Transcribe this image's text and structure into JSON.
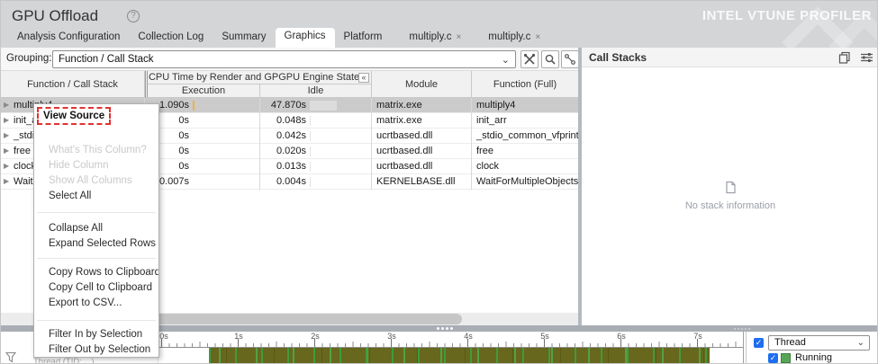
{
  "header": {
    "title": "GPU Offload",
    "help_icon": "?",
    "brand": "INTEL VTUNE PROFILER"
  },
  "tabs": [
    {
      "label": "Analysis Configuration",
      "active": false,
      "closable": false
    },
    {
      "label": "Collection Log",
      "active": false,
      "closable": false
    },
    {
      "label": "Summary",
      "active": false,
      "closable": false
    },
    {
      "label": "Graphics",
      "active": true,
      "closable": false
    },
    {
      "label": "Platform",
      "active": false,
      "closable": false
    },
    {
      "label": "multiply.c",
      "active": false,
      "closable": true,
      "close_glyph": "×"
    },
    {
      "label": "multiply.c",
      "active": false,
      "closable": true,
      "close_glyph": "×"
    }
  ],
  "grouping": {
    "label": "Grouping:",
    "value": "Function / Call Stack",
    "buttons": [
      "customize-grouping",
      "search",
      "grouping-path"
    ]
  },
  "table": {
    "col_function": "Function / Call Stack",
    "group_header": "CPU Time by Render and GPGPU Engine State",
    "group_sort_glyph": "▼",
    "group_collapse_glyph": "«",
    "col_execution": "Execution",
    "col_idle": "Idle",
    "col_module": "Module",
    "col_function_full": "Function (Full)",
    "expand_glyph": "▶",
    "rows": [
      {
        "name": "multiply4",
        "execution": "1.090s",
        "idle": "47.870s",
        "module": "matrix.exe",
        "function_full": "multiply4",
        "selected": true
      },
      {
        "name": "init_arr",
        "execution": "0s",
        "idle": "0.048s",
        "module": "matrix.exe",
        "function_full": "init_arr",
        "selected": false
      },
      {
        "name": "_stdio_common_vfprintf",
        "execution": "0s",
        "idle": "0.042s",
        "module": "ucrtbased.dll",
        "function_full": "_stdio_common_vfprintf",
        "selected": false
      },
      {
        "name": "free",
        "execution": "0s",
        "idle": "0.020s",
        "module": "ucrtbased.dll",
        "function_full": "free",
        "selected": false
      },
      {
        "name": "clock",
        "execution": "0s",
        "idle": "0.013s",
        "module": "ucrtbased.dll",
        "function_full": "clock",
        "selected": false
      },
      {
        "name": "WaitForMultipleObjects",
        "execution": "0.007s",
        "idle": "0.004s",
        "module": "KERNELBASE.dll",
        "function_full": "WaitForMultipleObjects",
        "selected": false
      }
    ]
  },
  "context_menu": {
    "items": [
      {
        "label": "View Source",
        "state": "highlighted"
      },
      {
        "label": "What's This Column?",
        "state": "disabled"
      },
      {
        "label": "Hide Column",
        "state": "disabled"
      },
      {
        "label": "Show All Columns",
        "state": "disabled"
      },
      {
        "label": "Select All",
        "state": "normal"
      },
      {
        "label": "Collapse All",
        "state": "normal"
      },
      {
        "label": "Expand Selected Rows",
        "state": "normal"
      },
      {
        "label": "Copy Rows to Clipboard",
        "state": "normal"
      },
      {
        "label": "Copy Cell to Clipboard",
        "state": "normal"
      },
      {
        "label": "Export to CSV...",
        "state": "normal"
      },
      {
        "label": "Filter In by Selection",
        "state": "normal"
      },
      {
        "label": "Filter Out by Selection",
        "state": "normal"
      }
    ]
  },
  "call_stacks": {
    "title": "Call Stacks",
    "empty_message": "No stack information"
  },
  "timeline": {
    "ticks": [
      "0s",
      "1s",
      "2s",
      "3s",
      "4s",
      "5s",
      "6s",
      "7s"
    ],
    "thread_label": "Thread (TID: ...)"
  },
  "legend": {
    "group_checkbox_checked": true,
    "group_label": "Thread",
    "check_glyph": "✓",
    "items": [
      {
        "label": "Running",
        "checked": true,
        "color": "#57a657"
      }
    ]
  },
  "colors": {
    "top_strip": "#d3d5d7",
    "selected_row": "#cbcbcb",
    "execution_bar": "#eeb243",
    "idle_bar": "#dcdcdc",
    "menu_highlight_border": "#e03232",
    "checkbox_blue": "#1e6ef0",
    "running_green": "#57a657",
    "band_olive": "#67671e",
    "band_green": "#3e9e3e"
  }
}
